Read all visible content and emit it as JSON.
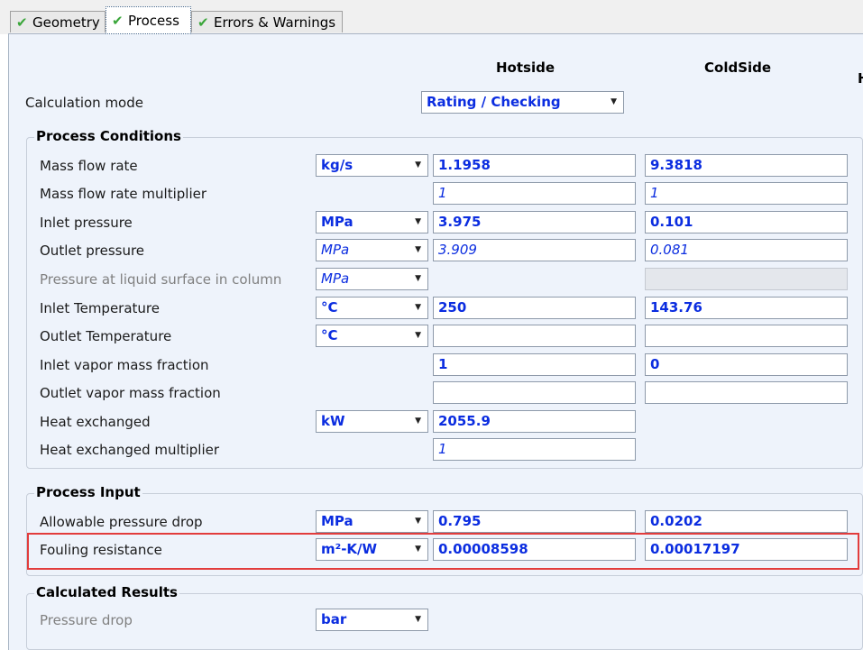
{
  "tabs": [
    {
      "label": "Geometry",
      "icon": "check-icon"
    },
    {
      "label": "Process",
      "icon": "check-icon"
    },
    {
      "label": "Errors & Warnings",
      "icon": "check-icon"
    }
  ],
  "columns": {
    "hot": "Hotside",
    "cold": "ColdSide",
    "partial": "H"
  },
  "calc_mode": {
    "label": "Calculation mode",
    "value": "Rating / Checking"
  },
  "process_conditions": {
    "title": "Process Conditions",
    "rows": [
      {
        "label": "Mass flow rate",
        "unit": "kg/s",
        "hot": "1.1958",
        "cold": "9.3818"
      },
      {
        "label": "Mass flow rate multiplier",
        "unit": "",
        "hot": "1",
        "cold": "1"
      },
      {
        "label": "Inlet pressure",
        "unit": "MPa",
        "hot": "3.975",
        "cold": "0.101"
      },
      {
        "label": "Outlet pressure",
        "unit": "MPa",
        "hot": "3.909",
        "cold": "0.081"
      },
      {
        "label": "Pressure at liquid surface in column",
        "unit": "MPa",
        "hot": "",
        "cold": ""
      },
      {
        "label": "Inlet Temperature",
        "unit": "°C",
        "hot": "250",
        "cold": "143.76"
      },
      {
        "label": "Outlet Temperature",
        "unit": "°C",
        "hot": "",
        "cold": ""
      },
      {
        "label": "Inlet vapor mass fraction",
        "unit": "",
        "hot": "1",
        "cold": "0"
      },
      {
        "label": "Outlet vapor mass fraction",
        "unit": "",
        "hot": "",
        "cold": ""
      },
      {
        "label": "Heat exchanged",
        "unit": "kW",
        "hot": "2055.9",
        "cold": ""
      },
      {
        "label": "Heat exchanged multiplier",
        "unit": "",
        "hot": "1",
        "cold": ""
      }
    ]
  },
  "process_input": {
    "title": "Process Input",
    "rows": [
      {
        "label": "Allowable pressure drop",
        "unit": "MPa",
        "hot": "0.795",
        "cold": "0.0202"
      },
      {
        "label": "Fouling resistance",
        "unit": "m²-K/W",
        "hot": "0.00008598",
        "cold": "0.00017197"
      }
    ]
  },
  "calculated_results": {
    "title": "Calculated Results",
    "rows": [
      {
        "label": "Pressure drop",
        "unit": "bar"
      }
    ]
  },
  "colors": {
    "value_text": "#0b2de0",
    "highlight": "#e23c3c",
    "panel_bg": "#eef3fb"
  }
}
